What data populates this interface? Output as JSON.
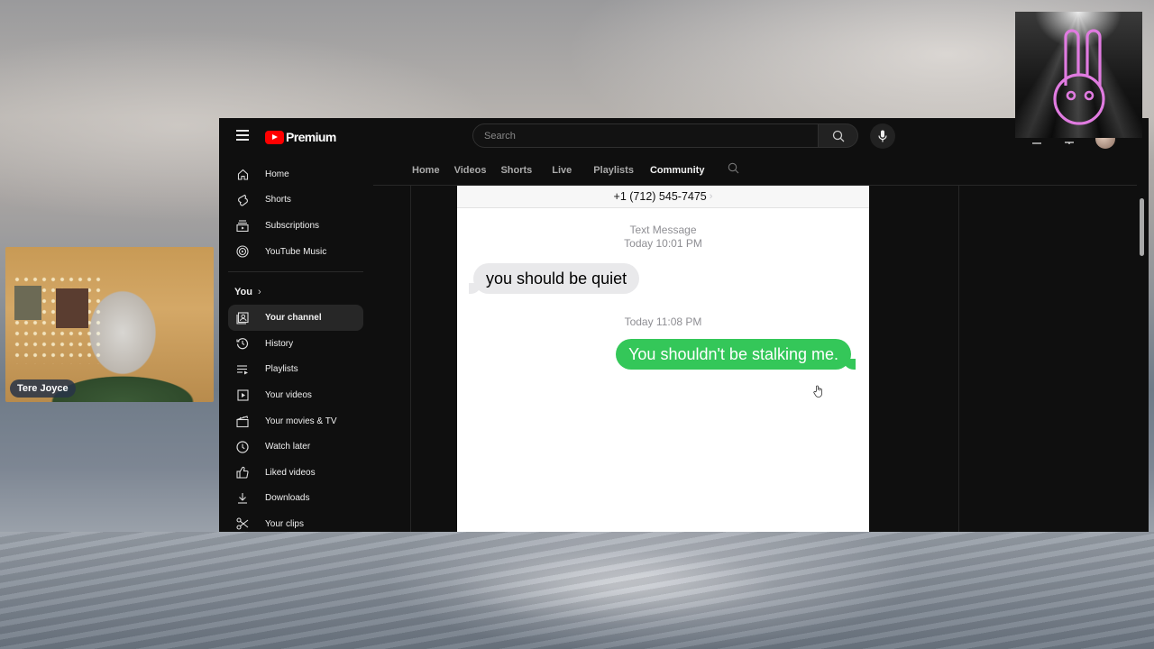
{
  "webcam": {
    "participant_name": "Tere Joyce"
  },
  "overlay_logo": {
    "icon": "bunny-logo-icon",
    "accent_color": "#e07be0"
  },
  "youtube": {
    "brand": "Premium",
    "search": {
      "placeholder": "Search"
    },
    "icons": {
      "menu": "hamburger-icon",
      "search": "search-icon",
      "mic": "microphone-icon",
      "create": "create-icon",
      "notifications": "notifications-icon"
    },
    "sidebar": {
      "main_items": [
        {
          "label": "Home",
          "icon": "home-icon"
        },
        {
          "label": "Shorts",
          "icon": "shorts-icon"
        },
        {
          "label": "Subscriptions",
          "icon": "subscriptions-icon"
        },
        {
          "label": "YouTube Music",
          "icon": "youtube-music-icon"
        }
      ],
      "you_section": {
        "title": "You",
        "chevron": "›",
        "items": [
          {
            "label": "Your channel",
            "icon": "your-channel-icon",
            "active": true
          },
          {
            "label": "History",
            "icon": "history-icon"
          },
          {
            "label": "Playlists",
            "icon": "playlists-icon"
          },
          {
            "label": "Your videos",
            "icon": "your-videos-icon"
          },
          {
            "label": "Your movies & TV",
            "icon": "movies-icon"
          },
          {
            "label": "Watch later",
            "icon": "watch-later-icon"
          },
          {
            "label": "Liked videos",
            "icon": "liked-videos-icon"
          },
          {
            "label": "Downloads",
            "icon": "downloads-icon"
          },
          {
            "label": "Your clips",
            "icon": "clips-icon"
          }
        ]
      }
    },
    "channel_tabs": [
      {
        "label": "Home"
      },
      {
        "label": "Videos"
      },
      {
        "label": "Shorts"
      },
      {
        "label": "Live"
      },
      {
        "label": "Playlists"
      },
      {
        "label": "Community",
        "active": true
      }
    ]
  },
  "message_screenshot": {
    "contact": "+1 (712) 545-7475",
    "contact_chevron": "›",
    "service_label": "Text Message",
    "first_timestamp": "Today 10:01 PM",
    "incoming_message": "you should be quiet",
    "second_timestamp": "Today 11:08 PM",
    "outgoing_message": "You shouldn't be stalking me.",
    "outgoing_color": "#34c759",
    "incoming_color": "#e9e9eb"
  }
}
